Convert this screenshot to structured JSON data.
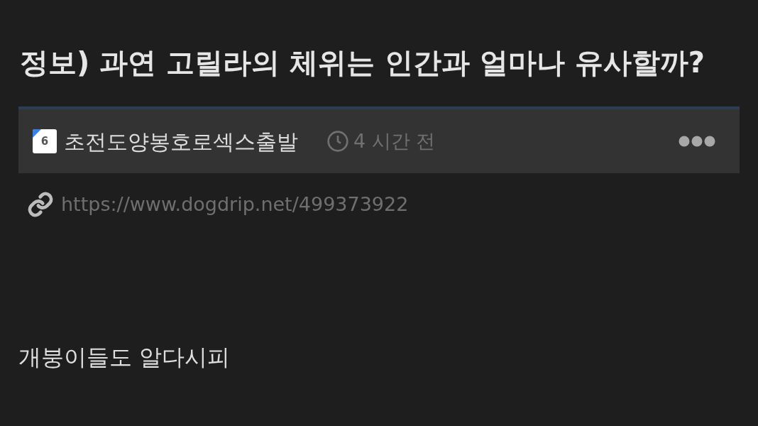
{
  "post": {
    "title": "정보) 과연 고릴라의 체위는 인간과 얼마나 유사할까?",
    "author": {
      "level": "6",
      "name": "초전도양봉호로섹스출발"
    },
    "time": "4 시간 전",
    "link": "https://www.dogdrip.net/499373922",
    "body": "개붕이들도 알다시피"
  }
}
